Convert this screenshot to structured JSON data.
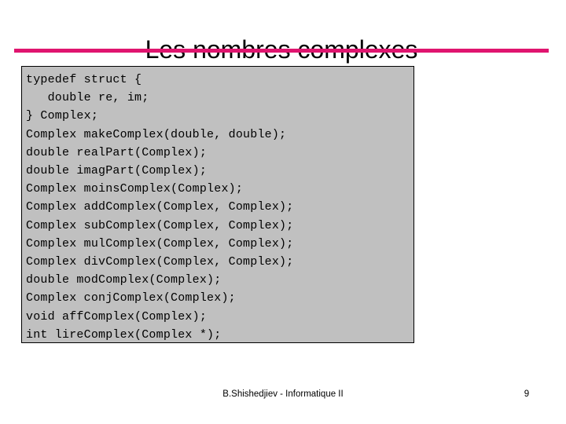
{
  "slide": {
    "title": "Les nombres complexes",
    "rule_color": "#E0156F",
    "background_color": "#FFFFFF"
  },
  "code_block": {
    "background_color": "#C0C0C0",
    "border_color": "#000000",
    "lines": [
      "typedef struct {",
      "   double re, im;",
      "} Complex;",
      "Complex makeComplex(double, double);",
      "double realPart(Complex);",
      "double imagPart(Complex);",
      "Complex moinsComplex(Complex);",
      "Complex addComplex(Complex, Complex);",
      "Complex subComplex(Complex, Complex);",
      "Complex mulComplex(Complex, Complex);",
      "Complex divComplex(Complex, Complex);",
      "double modComplex(Complex);",
      "Complex conjComplex(Complex);",
      "void affComplex(Complex);",
      "int lireComplex(Complex *);"
    ]
  },
  "footer": {
    "text": "B.Shishedjiev - Informatique II",
    "page_number": "9"
  }
}
